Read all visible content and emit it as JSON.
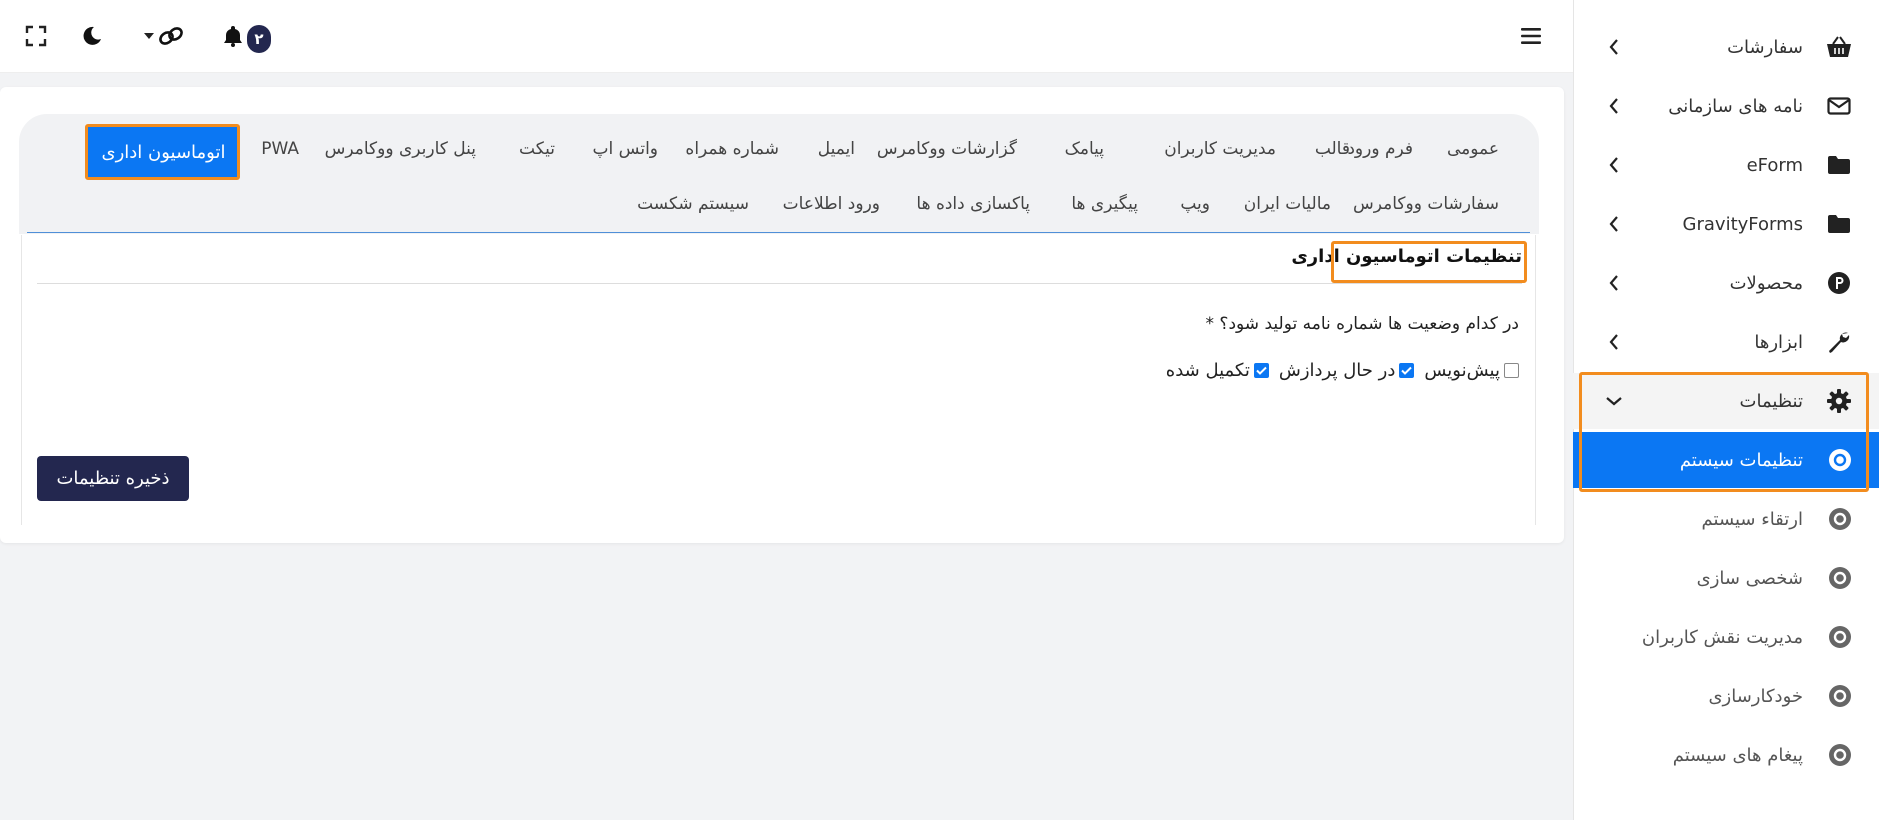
{
  "topbar": {
    "notification_count": "۲",
    "icons": [
      "fullscreen-icon",
      "moon-icon",
      "link-icon",
      "caret-down-icon",
      "bell-icon",
      "menu-icon"
    ]
  },
  "sidebar": {
    "items": [
      {
        "label": "سفارشات",
        "icon": "basket-icon"
      },
      {
        "label": "نامه های سازمانی",
        "icon": "envelope-icon"
      },
      {
        "label": "eForm",
        "icon": "folder-icon"
      },
      {
        "label": "GravityForms",
        "icon": "folder-icon"
      },
      {
        "label": "محصولات",
        "icon": "p-circle-icon"
      },
      {
        "label": "ابزارها",
        "icon": "wrench-icon"
      },
      {
        "label": "تنظیمات",
        "icon": "gear-icon"
      }
    ],
    "subitems": [
      {
        "label": "تنظیمات سیستم"
      },
      {
        "label": "ارتقاء سیستم"
      },
      {
        "label": "شخصی سازی"
      },
      {
        "label": "مدیریت نقش کاربران"
      },
      {
        "label": "خودکارسازی"
      },
      {
        "label": "پیغام های سیستم"
      }
    ]
  },
  "tabs": {
    "row1": [
      "عمومی",
      "فرم ورود",
      "قالب",
      "مدیریت کاربران",
      "پیامک",
      "گزارشات ووکامرس",
      "ایمیل",
      "شماره همراه",
      "واتس اپ",
      "تیکت",
      "پنل کاربری ووکامرس",
      "PWA"
    ],
    "active": "اتوماسیون اداری",
    "row2": [
      "سفارشات ووکامرس",
      "مالیات ایران",
      "ویپ",
      "پیگیری ها",
      "پاکسازی داده ها",
      "ورود اطلاعات",
      "سیستم شکست"
    ]
  },
  "section": {
    "title": "تنظیمات اتوماسیون اداری",
    "question": "در کدام وضعیت ها شماره نامه تولید شود؟ *",
    "options": [
      {
        "label": "پیش‌نویس",
        "checked": false
      },
      {
        "label": "در حال پردازش",
        "checked": true
      },
      {
        "label": "تکمیل شده",
        "checked": true
      }
    ],
    "save_label": "ذخیره تنظیمات"
  },
  "colors": {
    "accent": "#0b77f3",
    "highlight": "#f28c1e",
    "dark_button": "#23274f"
  }
}
